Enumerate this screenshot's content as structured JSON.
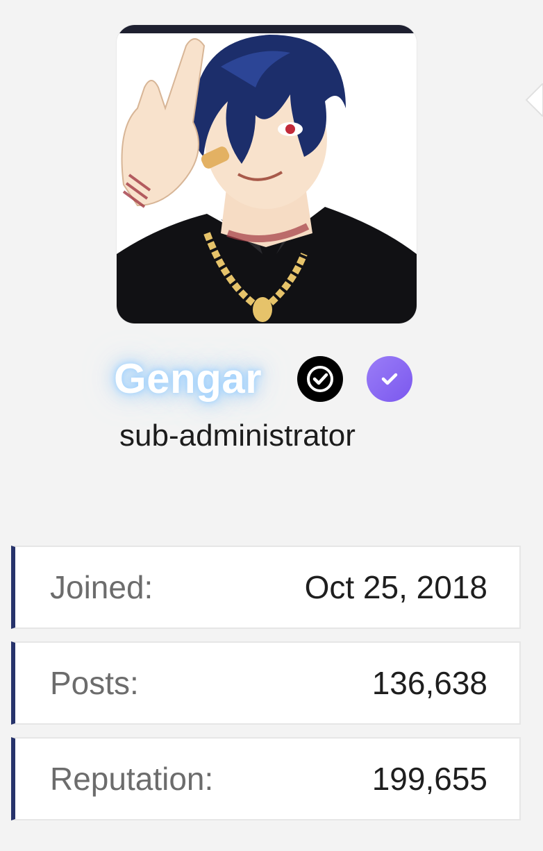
{
  "profile": {
    "username": "Gengar",
    "role": "sub-administrator",
    "avatar_icon": "anime-avatar",
    "badges": [
      {
        "name": "verified-black-badge",
        "color": "#000000"
      },
      {
        "name": "verified-purple-badge",
        "color": "#8b6cf3"
      }
    ]
  },
  "stats": [
    {
      "label": "Joined:",
      "value": "Oct 25, 2018"
    },
    {
      "label": "Posts:",
      "value": "136,638"
    },
    {
      "label": "Reputation:",
      "value": "199,655"
    }
  ],
  "colors": {
    "background": "#f3f3f3",
    "stat_accent": "#27336b",
    "name_glow": "#a0cfff"
  }
}
